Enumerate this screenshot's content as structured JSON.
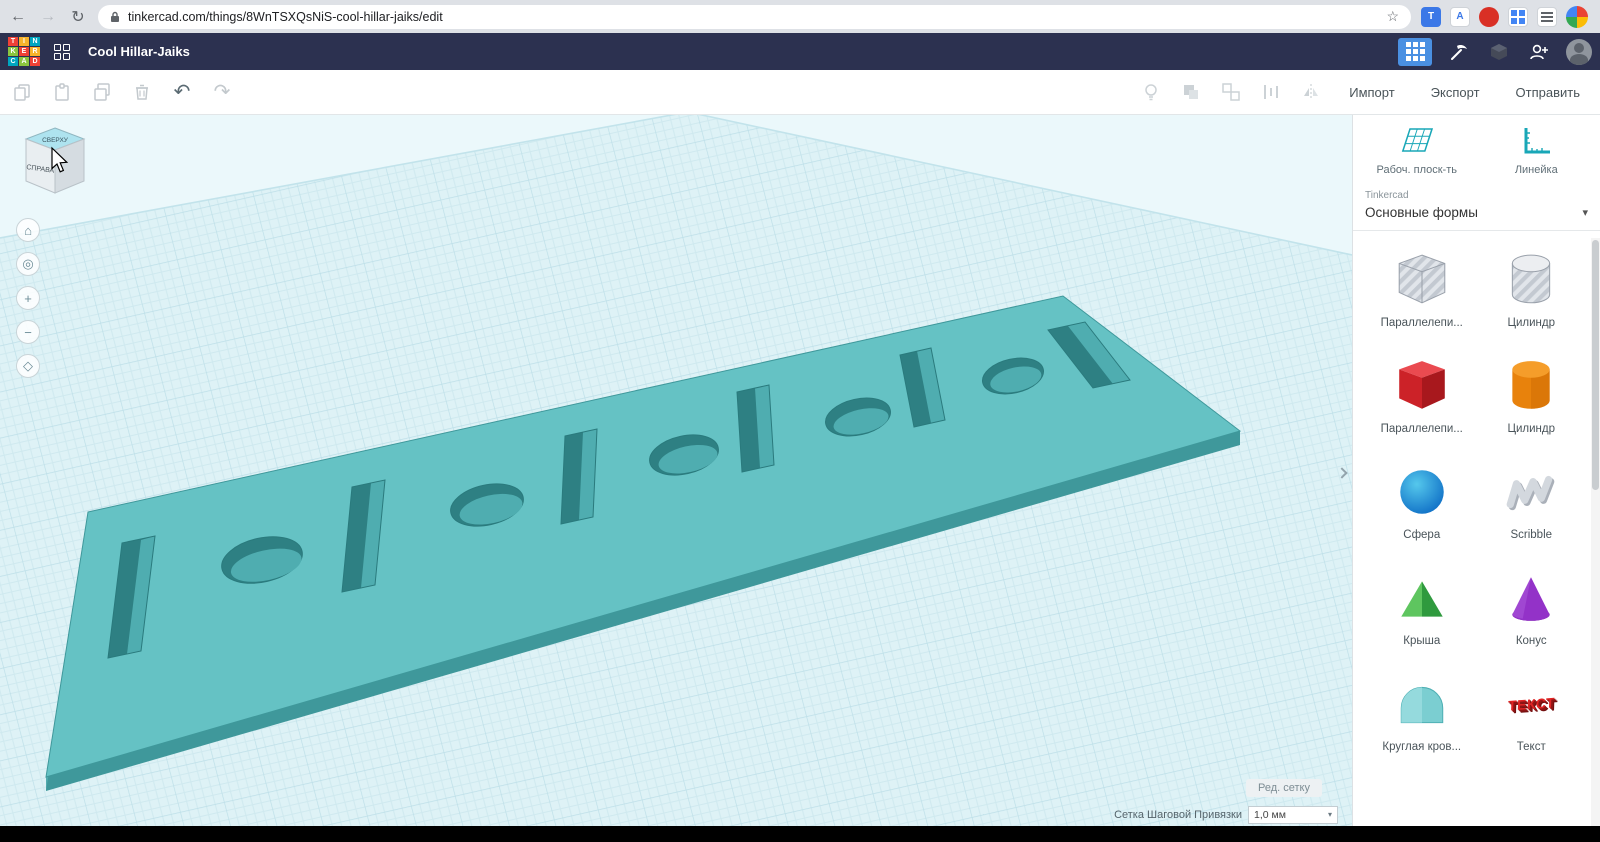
{
  "browser": {
    "url": "tinkercad.com/things/8WnTSXQsNiS-cool-hillar-jaiks/edit",
    "icons": {
      "back": "←",
      "forward": "→",
      "reload": "↻",
      "star": "☆"
    }
  },
  "header": {
    "logo_letters": [
      "T",
      "I",
      "N",
      "K",
      "E",
      "R",
      "C",
      "A",
      "D"
    ],
    "title": "Cool Hillar-Jaiks"
  },
  "toolbar": {
    "import": "Импорт",
    "export": "Экспорт",
    "send": "Отправить"
  },
  "viewcube": {
    "top": "СВЕРХУ",
    "front": "СПРАВА"
  },
  "nav": {
    "home": "⌂",
    "orbit": "◎",
    "zoom_in": "+",
    "zoom_out": "−",
    "perspective": "◇"
  },
  "canvas": {
    "edit_grid": "Ред. сетку",
    "snap_label": "Сетка Шаговой Привязки",
    "snap_value": "1,0 мм",
    "snap_caret": "▾"
  },
  "panel": {
    "workplane": "Рабоч. плоск-ть",
    "ruler": "Линейка",
    "brand": "Tinkercad",
    "category": "Основные формы",
    "category_caret": "▾",
    "shapes": [
      {
        "label": "Параллелепи..."
      },
      {
        "label": "Цилиндр"
      },
      {
        "label": "Параллелепи..."
      },
      {
        "label": "Цилиндр"
      },
      {
        "label": "Сфера"
      },
      {
        "label": "Scribble"
      },
      {
        "label": "Крыша"
      },
      {
        "label": "Конус"
      },
      {
        "label": "Круглая кров..."
      },
      {
        "label": "Текст"
      }
    ],
    "text_icon": "ТЕКСТ"
  },
  "colors": {
    "plate_top": "#65c2c4",
    "plate_side": "#3f989b",
    "workplane_grid": "#cfe9ef",
    "header_bg": "#2c3150",
    "accent": "#18a7b7"
  }
}
